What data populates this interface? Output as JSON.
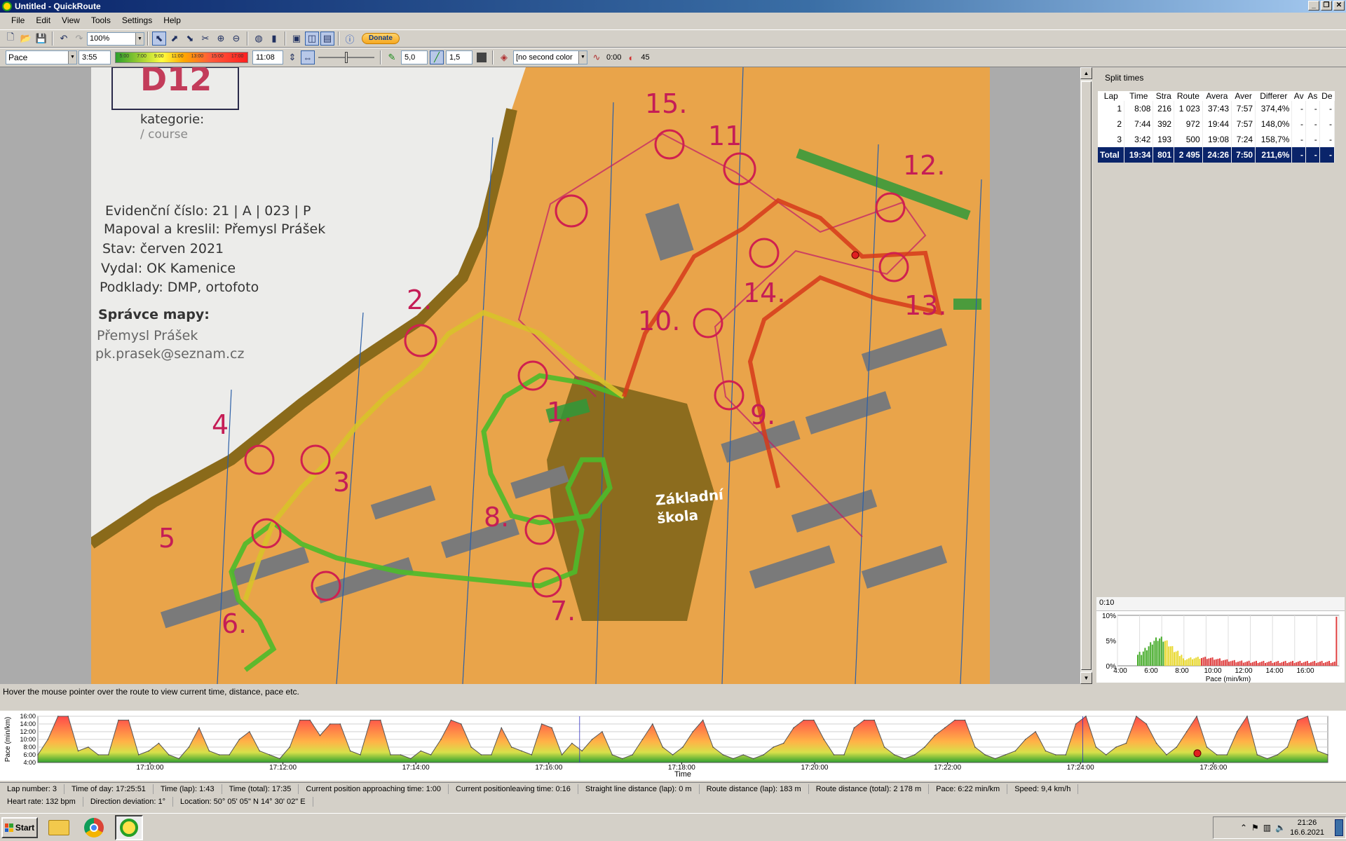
{
  "window": {
    "title": "Untitled - QuickRoute"
  },
  "menu": [
    "File",
    "Edit",
    "View",
    "Tools",
    "Settings",
    "Help"
  ],
  "toolbar": {
    "zoom": "100%",
    "donate_label": "Donate",
    "pace_attribute": "Pace",
    "min_value": "3:55",
    "scale_labels": [
      "5:00",
      "7:00",
      "9:00",
      "11:00",
      "13:00",
      "15:00",
      "17:00"
    ],
    "max_value": "11:08",
    "line_width": "5,0",
    "mask_width": "1,5",
    "second_color": "[no second color",
    "smoothing": "0:00",
    "direction": "45"
  },
  "map": {
    "title_partial": "D12",
    "kategorie": "kategorie:",
    "course": "/ course",
    "info_lines": [
      "Evidenční číslo: 21 | A | 023 | P",
      "Mapoval a kreslil: Přemysl Prášek",
      "Stav: červen 2021",
      "Vydal: OK Kamenice",
      "Podklady: DMP, ortofoto"
    ],
    "spravce": "Správce mapy:",
    "spravce_name": "Přemysl Prášek",
    "spravce_email": "pk.prasek@seznam.cz",
    "school_label": "Základní škola",
    "controls": [
      "1.",
      "2.",
      "3",
      "4",
      "5",
      "6.",
      "7.",
      "8.",
      "9.",
      "10.",
      "11",
      "12.",
      "13.",
      "14.",
      "15."
    ]
  },
  "split_times": {
    "title": "Split times",
    "headers": [
      "Lap",
      "Time",
      "Stra",
      "Route",
      "Avera",
      "Aver",
      "Differer",
      "Av",
      "As",
      "De"
    ],
    "rows": [
      [
        "1",
        "8:08",
        "216",
        "1 023",
        "37:43",
        "7:57",
        "374,4%",
        "-",
        "-",
        "-"
      ],
      [
        "2",
        "7:44",
        "392",
        "972",
        "19:44",
        "7:57",
        "148,0%",
        "-",
        "-",
        "-"
      ],
      [
        "3",
        "3:42",
        "193",
        "500",
        "19:08",
        "7:24",
        "158,7%",
        "-",
        "-",
        "-"
      ]
    ],
    "total": [
      "Total",
      "19:34",
      "801",
      "2 495",
      "24:26",
      "7:50",
      "211,6%",
      "-",
      "-",
      "-"
    ]
  },
  "histogram": {
    "interval": "0:10",
    "ylabels": [
      "10%",
      "5%",
      "0%"
    ],
    "xlabels": [
      "4:00",
      "6:00",
      "8:00",
      "10:00",
      "12:00",
      "14:00",
      "16:00"
    ],
    "xlabel": "Pace (min/km)"
  },
  "hover_status": "Hover the mouse pointer over the route to view current time, distance, pace etc.",
  "lap_chart": {
    "ylabel": "Pace (min/km)",
    "yticks": [
      "16:00",
      "14:00",
      "12:00",
      "10:00",
      "8:00",
      "6:00",
      "4:00"
    ],
    "xticks": [
      "17:10:00",
      "17:12:00",
      "17:14:00",
      "17:16:00",
      "17:18:00",
      "17:20:00",
      "17:22:00",
      "17:24:00",
      "17:26:00"
    ],
    "xlabel": "Time"
  },
  "chart_data": {
    "type": "area",
    "title": "",
    "xlabel": "Time",
    "ylabel": "Pace (min/km)",
    "ylim": [
      4,
      16
    ],
    "x_ticks": [
      "17:10:00",
      "17:12:00",
      "17:14:00",
      "17:16:00",
      "17:18:00",
      "17:20:00",
      "17:22:00",
      "17:24:00",
      "17:26:00"
    ],
    "series": [
      {
        "values": [
          6,
          10,
          16,
          16,
          7,
          8,
          6,
          6,
          15,
          15,
          6,
          7,
          9,
          6,
          5,
          8,
          13,
          7,
          6,
          6,
          10,
          12,
          7,
          6,
          5,
          8,
          15,
          15,
          11,
          14,
          14,
          7,
          6,
          15,
          15,
          6,
          6,
          5,
          7,
          6,
          10,
          15,
          14,
          8,
          6,
          6,
          13,
          8,
          7,
          6,
          14,
          13,
          6,
          9,
          7,
          10,
          12,
          6,
          5,
          6,
          10,
          14,
          8,
          6,
          8,
          12,
          15,
          8,
          6,
          5,
          6,
          5,
          6,
          8,
          9,
          13,
          15,
          15,
          10,
          6,
          6,
          13,
          15,
          15,
          8,
          6,
          5,
          6,
          8,
          11,
          13,
          15,
          15,
          8,
          6,
          5,
          6,
          7,
          10,
          12,
          7,
          6,
          6,
          14,
          16,
          8,
          6,
          8,
          9,
          16,
          14,
          9,
          6,
          8,
          12,
          16,
          8,
          6,
          6,
          12,
          16,
          6,
          5,
          6,
          8,
          15,
          16,
          7,
          6
        ]
      }
    ]
  },
  "info": {
    "row1": [
      "Lap number: 3",
      "Time of day: 17:25:51",
      "Time (lap): 1:43",
      "Time (total): 17:35",
      "Current position approaching time: 1:00",
      "Current positionleaving time: 0:16",
      "Straight line distance (lap): 0 m",
      "Route distance (lap): 183 m",
      "Route distance (total): 2 178 m",
      "Pace: 6:22 min/km",
      "Speed: 9,4 km/h"
    ],
    "row2": [
      "Heart rate: 132 bpm",
      "Direction deviation: 1°",
      "Location: 50° 05' 05\" N   14° 30' 02\" E"
    ]
  },
  "taskbar": {
    "start_label": "Start",
    "time": "21:26",
    "date": "16.6.2021"
  }
}
